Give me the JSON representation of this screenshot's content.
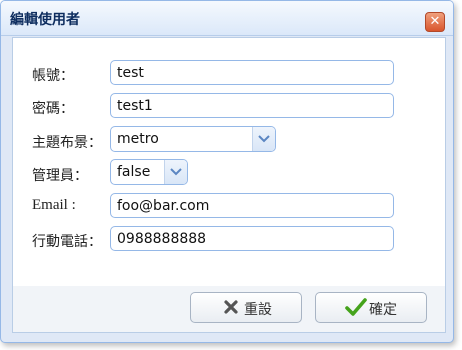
{
  "dialog": {
    "title": "編輯使用者",
    "close_icon": "close-icon"
  },
  "form": {
    "account": {
      "label": "帳號：",
      "value": "test"
    },
    "password": {
      "label": "密碼：",
      "value": "test1"
    },
    "theme": {
      "label": "主題布景：",
      "value": "metro"
    },
    "admin": {
      "label": "管理員：",
      "value": "false"
    },
    "email": {
      "label": "Email :",
      "value": "foo@bar.com"
    },
    "mobile": {
      "label": "行動電話：",
      "value": "0988888888"
    }
  },
  "buttons": {
    "reset": {
      "label": "重設",
      "icon": "x-icon"
    },
    "confirm": {
      "label": "確定",
      "icon": "checkmark-icon"
    }
  },
  "colors": {
    "border": "#95b8e7",
    "close_button": "#d9552d",
    "check_green": "#45a31c",
    "x_gray": "#555555"
  }
}
